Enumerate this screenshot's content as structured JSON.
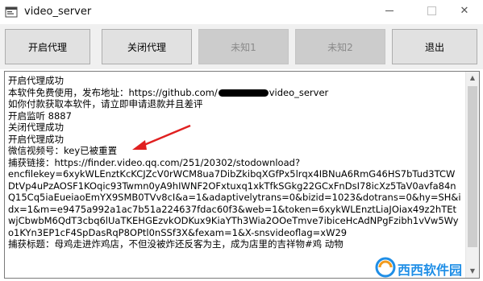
{
  "window": {
    "title": "video_server",
    "controls": [
      "minimize",
      "maximize",
      "close"
    ],
    "close_glyph": "✕"
  },
  "toolbar": {
    "buttons": [
      {
        "label": "开启代理",
        "enabled": true
      },
      {
        "label": "关闭代理",
        "enabled": true
      },
      {
        "label": "未知1",
        "enabled": false
      },
      {
        "label": "未知2",
        "enabled": false
      },
      {
        "label": "退出",
        "enabled": true
      }
    ]
  },
  "log": {
    "lines": [
      "开启代理成功",
      "本软件免费使用，发布地址：https://github.com/",
      "video_server",
      "如你付款获取本软件，请立即申请退款并且差评",
      "开启监听 8887",
      "关闭代理成功",
      "开启代理成功",
      "微信视频号：key已被重置",
      "捕获链接：https://finder.video.qq.com/251/20302/stodownload?",
      "encfilekey=6xykWLEnztKcKCJZcV0rWCM8ua7DibZkibqXGfPx5lrqx4IBNuA6RmG46HS7bTud3TCWDtVp4uPzAOSF1KOqic93Twmn0yA9hIWNF2OFxtuxq1xkTfkSGkg22GCxFnDsI78icXz5TaV0avfa84nQ15Cq5iaEueiaoEmYX9SMB0TVv8cI&a=1&adaptivelytrans=0&bizid=1023&dotrans=0&hy=SH&idx=1&m=e9475a992a1ac7b51a224637fdac60f3&web=1&token=6xykWLEnztLiaJOiax49z2hTEtwjCbwbM6QdT3cbq6lUaTKEHGEzvkODKux9KiaYTh3Wia2OOeTmve7ibiceHcAdNPgFzibh1vVw5Wyo1KYn3EP1cF4SpDasRqP8OPtl0nSSf3X&fexam=1&X-snsvideoflag=xW29",
      "捕获标题：母鸡走进炸鸡店，不但没被炸还反客为主，成为店里的吉祥物#鸡 动物"
    ]
  },
  "watermark": {
    "text": "西西软件园"
  },
  "colors": {
    "arrow": "#e02020",
    "watermark": "#1f8ee6",
    "disabled_text": "#8a8a8a"
  }
}
